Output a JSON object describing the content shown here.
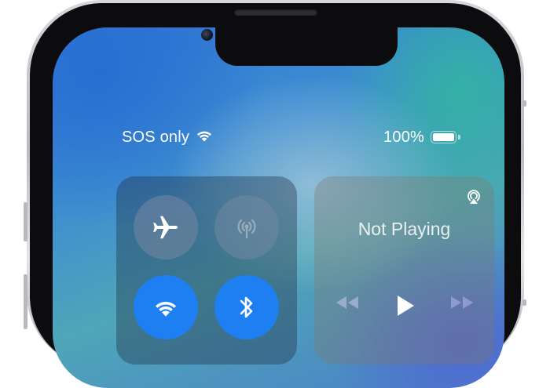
{
  "status_bar": {
    "carrier": "SOS only",
    "battery_percent": "100%",
    "battery_level": 1.0
  },
  "connectivity": {
    "airplane_mode": "on",
    "cellular_data": "disabled",
    "wifi": "on",
    "bluetooth": "on"
  },
  "media": {
    "now_playing": "Not Playing"
  },
  "colors": {
    "toggle_active": "#1e7ff3",
    "wallpaper_blue": "#2f73d6",
    "wallpaper_teal": "#32b4a0"
  },
  "icons": [
    "wifi-icon",
    "battery-icon",
    "airplane-icon",
    "cellular-antenna-icon",
    "bluetooth-icon",
    "airplay-icon",
    "rewind-icon",
    "play-icon",
    "fast-forward-icon"
  ]
}
